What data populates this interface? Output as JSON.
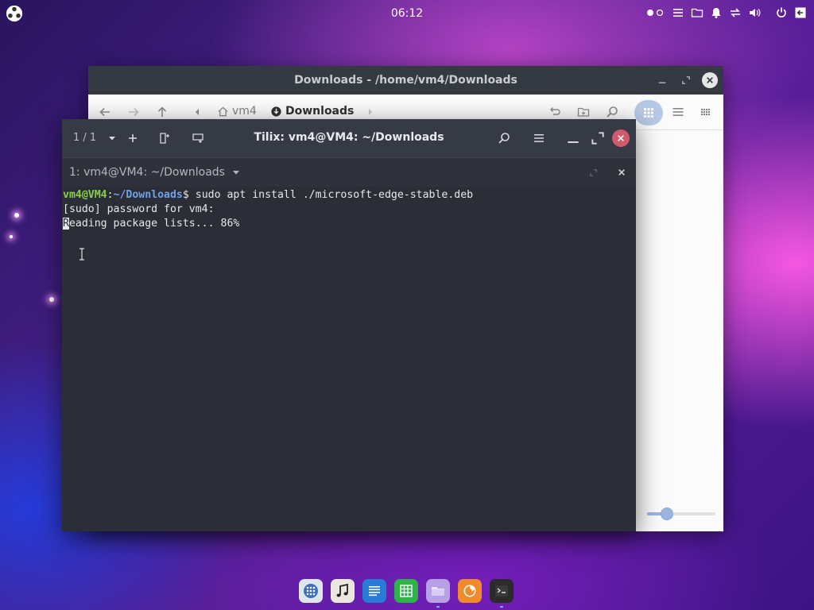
{
  "topbar": {
    "clock": "06:12",
    "icons": [
      "distro-logo-icon",
      "workspace-dots-icon",
      "menu-icon",
      "folder-icon",
      "bell-icon",
      "network-icon",
      "volume-icon",
      "power-icon",
      "logout-icon"
    ]
  },
  "file_manager": {
    "title": "Downloads - /home/vm4/Downloads",
    "breadcrumbs": [
      {
        "label": "vm4",
        "icon": "home-icon"
      },
      {
        "label": "Downloads",
        "icon": "download-icon"
      }
    ],
    "icons": [
      "back-icon",
      "forward-icon",
      "up-icon",
      "crumb-left-icon",
      "crumb-right-icon",
      "history-icon",
      "new-folder-icon",
      "search-icon",
      "grid-view-icon",
      "list-view-icon",
      "compact-view-icon"
    ],
    "accent": "#b7c9e4",
    "zoom_level": 0.28
  },
  "terminal": {
    "session_counter": "1 / 1",
    "title": "Tilix: vm4@VM4: ~/Downloads",
    "tab_label": "1: vm4@VM4: ~/Downloads",
    "prompt_user": "vm4@VM4",
    "prompt_sep": ":",
    "prompt_path": "~/Downloads",
    "prompt_symbol": "$ ",
    "command": "sudo apt install ./microsoft-edge-stable.deb",
    "line2": "[sudo] password for vm4:",
    "line3_first": "R",
    "line3_rest": "eading package lists... 86%",
    "colors": {
      "user": "#87d142",
      "path": "#6fa3e8",
      "close": "#d05a6b"
    }
  },
  "dock": {
    "items": [
      {
        "name": "app-grid-icon",
        "color": "#dfe6ef"
      },
      {
        "name": "music-icon",
        "color": "#e9e7e0"
      },
      {
        "name": "text-editor-icon",
        "color": "#2a7ad8"
      },
      {
        "name": "spreadsheet-icon",
        "color": "#2db34a"
      },
      {
        "name": "files-icon",
        "color": "#b7a0e6"
      },
      {
        "name": "firefox-icon",
        "color": "#f08a2c"
      },
      {
        "name": "terminal-icon",
        "color": "#2b2b2b"
      }
    ]
  }
}
